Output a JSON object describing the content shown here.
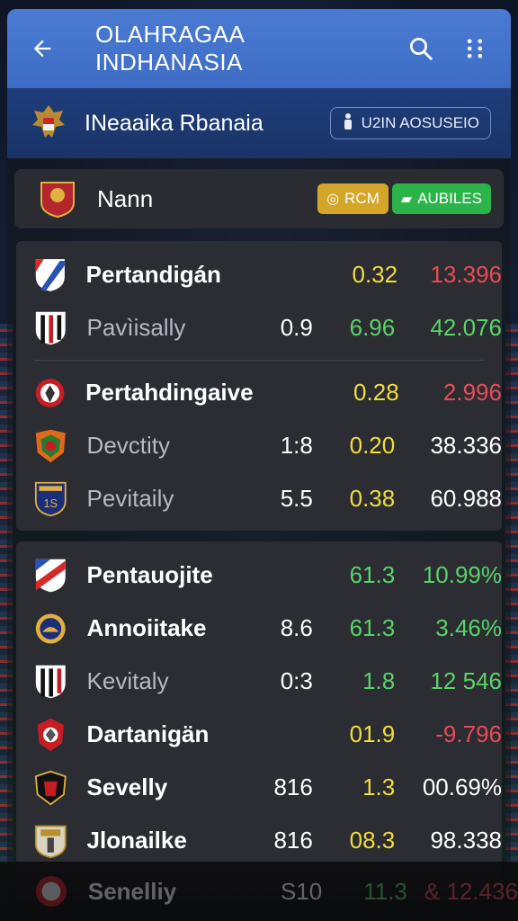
{
  "appbar": {
    "title": "OLAHRAGAA INDHANASIA"
  },
  "league": {
    "name": "INeaaika Rbanaia",
    "button_label": "U2IN AOSUSEIO"
  },
  "filter": {
    "name": "Nann",
    "chip_yellow": "RCM",
    "chip_green": "AUBILES"
  },
  "sections": [
    {
      "rows": [
        {
          "team": "Pertandigán",
          "c1": "",
          "c2": "0.32",
          "c3": "13.396",
          "c2_color": "yellow",
          "c3_color": "red",
          "bold": true
        },
        {
          "team": "Pavìisally",
          "c1": "0.9",
          "c2": "6.96",
          "c3": "42.076",
          "c2_color": "green",
          "c3_color": "green-red",
          "bold": false
        }
      ]
    },
    {
      "rows": [
        {
          "team": "Pertahdingaive",
          "c1": "",
          "c2": "0.28",
          "c3": "2.996",
          "c2_color": "yellow",
          "c3_color": "red",
          "bold": true
        },
        {
          "team": "Devctity",
          "c1": "1:8",
          "c2": "0.20",
          "c3": "38.336",
          "c2_color": "yellow",
          "c3_color": "white-red",
          "bold": false
        },
        {
          "team": "Pevitaily",
          "c1": "5.5",
          "c2": "0.38",
          "c3": "60.988",
          "c2_color": "yellow",
          "c3_color": "white-red",
          "bold": false
        }
      ]
    },
    {
      "rows": [
        {
          "team": "Pentauojite",
          "c1": "",
          "c2": "61.3",
          "c3": "10.99%",
          "c2_color": "green",
          "c3_color": "green",
          "bold": true
        },
        {
          "team": "Annoiitake",
          "c1": "8.6",
          "c2": "61.3",
          "c3": "3.46%",
          "c2_color": "green",
          "c3_color": "green",
          "bold": true
        },
        {
          "team": "Kevitaly",
          "c1": "0:3",
          "c2": "1.8",
          "c3": "12 546",
          "c2_color": "green",
          "c3_color": "green-red",
          "bold": false
        },
        {
          "team": "Dartanigän",
          "c1": "",
          "c2": "01.9",
          "c3": "-9.796",
          "c2_color": "yellow",
          "c3_color": "red",
          "bold": true
        },
        {
          "team": "Sevelly",
          "c1": "816",
          "c2": "1.3",
          "c3": "00.69%",
          "c2_color": "yellow",
          "c3_color": "white-red",
          "bold": true
        },
        {
          "team": "Jlonailke",
          "c1": "816",
          "c2": "08.3",
          "c3": "98.338",
          "c2_color": "yellow",
          "c3_color": "white-red",
          "bold": true
        }
      ]
    }
  ],
  "faded_row": {
    "team": "Senelliy",
    "c1": "S10",
    "c2": "11.3",
    "c3": "& 12.436"
  },
  "colors": {
    "appbar": "#4a7bd3",
    "league_bar": "#1e3d7a",
    "yellow": "#f1dd3c",
    "green": "#58d36a",
    "red": "#e84b55"
  }
}
